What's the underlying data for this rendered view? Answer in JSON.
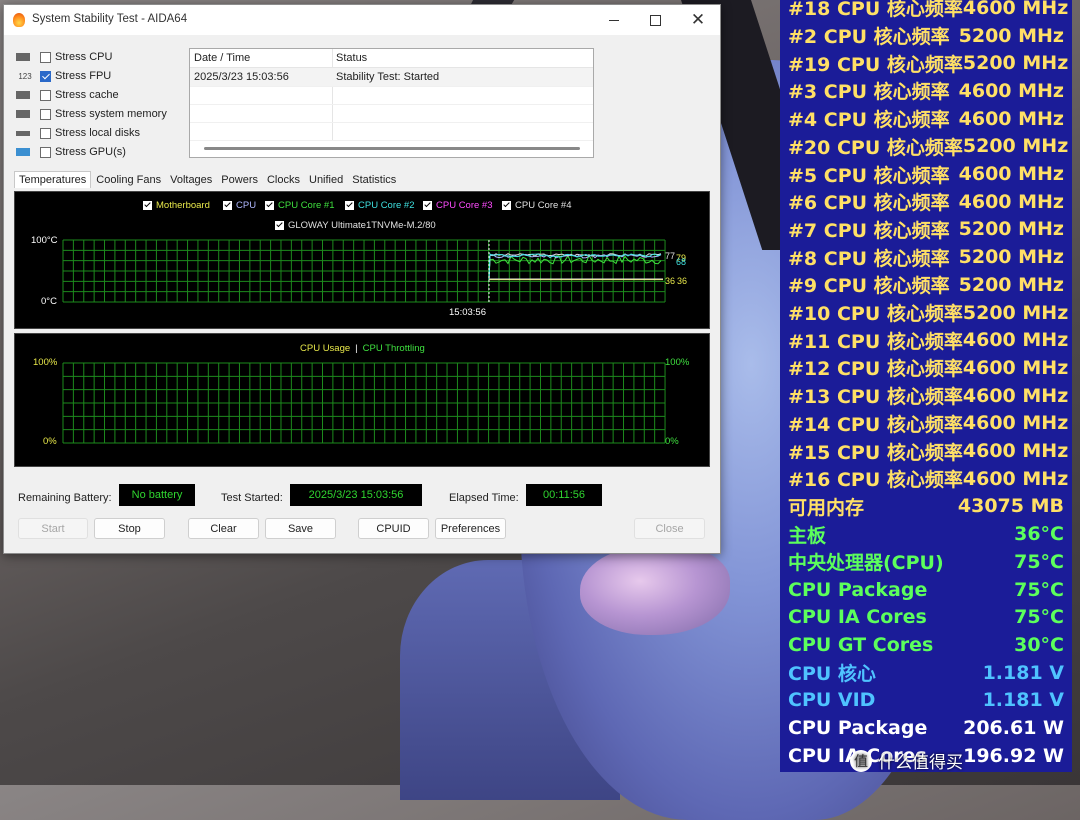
{
  "window": {
    "title": "System Stability Test - AIDA64",
    "minimize_glyph": "",
    "close_glyph": "✕"
  },
  "stress_options": [
    {
      "label": "Stress CPU",
      "checked": false,
      "icon": "cpu-chip-icon"
    },
    {
      "label": "Stress FPU",
      "checked": true,
      "icon": "fpu-123-icon",
      "icon_text": "123"
    },
    {
      "label": "Stress cache",
      "checked": false,
      "icon": "cache-chip-icon"
    },
    {
      "label": "Stress system memory",
      "checked": false,
      "icon": "memory-module-icon"
    },
    {
      "label": "Stress local disks",
      "checked": false,
      "icon": "disk-drive-icon"
    },
    {
      "label": "Stress GPU(s)",
      "checked": false,
      "icon": "gpu-monitor-icon"
    }
  ],
  "log": {
    "col_date": "Date / Time",
    "col_status": "Status",
    "rows": [
      {
        "date": "2025/3/23 15:03:56",
        "status": "Stability Test: Started"
      }
    ]
  },
  "tabs": [
    "Temperatures",
    "Cooling Fans",
    "Voltages",
    "Powers",
    "Clocks",
    "Unified",
    "Statistics"
  ],
  "temp_graph": {
    "legend": [
      {
        "label": "Motherboard",
        "color": "#e8e84a"
      },
      {
        "label": "CPU",
        "color": "#b0b8ff"
      },
      {
        "label": "CPU Core #1",
        "color": "#3fe03f"
      },
      {
        "label": "CPU Core #2",
        "color": "#3fe0e0"
      },
      {
        "label": "CPU Core #3",
        "color": "#ff4cff"
      },
      {
        "label": "CPU Core #4",
        "color": "#e0e0e0"
      }
    ],
    "legend2": {
      "label": "GLOWAY Ultimate1TNVMe-M.2/80",
      "color": "#e0e0e0"
    },
    "y_max": "100",
    "y_min": "0",
    "unit": "°C",
    "time": "15:03:56",
    "readouts": [
      "77",
      "79",
      "68",
      "36",
      "36"
    ]
  },
  "usage_graph": {
    "legend_a": {
      "label": "CPU Usage",
      "color": "#e8e84a"
    },
    "separator": "|",
    "legend_b": {
      "label": "CPU Throttling",
      "color": "#3fe03f"
    },
    "left_max": "100%",
    "left_min": "0%",
    "right_max": "100%",
    "right_min": "0%"
  },
  "status": {
    "battery_label": "Remaining Battery:",
    "battery_value": "No battery",
    "started_label": "Test Started:",
    "started_value": "2025/3/23 15:03:56",
    "elapsed_label": "Elapsed Time:",
    "elapsed_value": "00:11:56"
  },
  "buttons": {
    "start": "Start",
    "stop": "Stop",
    "clear": "Clear",
    "save": "Save",
    "cpuid": "CPUID",
    "preferences": "Preferences",
    "close": "Close"
  },
  "overlay": {
    "rows": [
      {
        "label": "#18 CPU 核心频率",
        "value": "4600 MHz",
        "color": "#ffe066"
      },
      {
        "label": "#2 CPU 核心频率",
        "value": "5200 MHz",
        "color": "#ffe066"
      },
      {
        "label": "#19 CPU 核心频率",
        "value": "5200 MHz",
        "color": "#ffe066"
      },
      {
        "label": "#3 CPU 核心频率",
        "value": "4600 MHz",
        "color": "#ffe066"
      },
      {
        "label": "#4 CPU 核心频率",
        "value": "4600 MHz",
        "color": "#ffe066"
      },
      {
        "label": "#20 CPU 核心频率",
        "value": "5200 MHz",
        "color": "#ffe066"
      },
      {
        "label": "#5 CPU 核心频率",
        "value": "4600 MHz",
        "color": "#ffe066"
      },
      {
        "label": "#6 CPU 核心频率",
        "value": "4600 MHz",
        "color": "#ffe066"
      },
      {
        "label": "#7 CPU 核心频率",
        "value": "5200 MHz",
        "color": "#ffe066"
      },
      {
        "label": "#8 CPU 核心频率",
        "value": "5200 MHz",
        "color": "#ffe066"
      },
      {
        "label": "#9 CPU 核心频率",
        "value": "5200 MHz",
        "color": "#ffe066"
      },
      {
        "label": "#10 CPU 核心频率",
        "value": "5200 MHz",
        "color": "#ffe066"
      },
      {
        "label": "#11 CPU 核心频率",
        "value": "4600 MHz",
        "color": "#ffe066"
      },
      {
        "label": "#12 CPU 核心频率",
        "value": "4600 MHz",
        "color": "#ffe066"
      },
      {
        "label": "#13 CPU 核心频率",
        "value": "4600 MHz",
        "color": "#ffe066"
      },
      {
        "label": "#14 CPU 核心频率",
        "value": "4600 MHz",
        "color": "#ffe066"
      },
      {
        "label": "#15 CPU 核心频率",
        "value": "4600 MHz",
        "color": "#ffe066"
      },
      {
        "label": "#16 CPU 核心频率",
        "value": "4600 MHz",
        "color": "#ffe066"
      },
      {
        "label": "可用内存",
        "value": "43075 MB",
        "color": "#ffe066"
      },
      {
        "label": "主板",
        "value": "36°C",
        "color": "#5cff5c"
      },
      {
        "label": "中央处理器(CPU)",
        "value": "75°C",
        "color": "#5cff5c"
      },
      {
        "label": "CPU Package",
        "value": "75°C",
        "color": "#5cff5c"
      },
      {
        "label": "CPU IA Cores",
        "value": "75°C",
        "color": "#5cff5c"
      },
      {
        "label": "CPU GT Cores",
        "value": "30°C",
        "color": "#5cff5c"
      },
      {
        "label": "CPU 核心",
        "value": "1.181 V",
        "color": "#4fc3ff"
      },
      {
        "label": "CPU VID",
        "value": "1.181 V",
        "color": "#4fc3ff"
      },
      {
        "label": "CPU Package",
        "value": "206.61 W",
        "color": "#ffffff"
      },
      {
        "label": "CPU IA Cores",
        "value": "196.92 W",
        "color": "#ffffff"
      }
    ]
  },
  "watermark": {
    "icon_text": "值",
    "text": "什么值得买"
  }
}
